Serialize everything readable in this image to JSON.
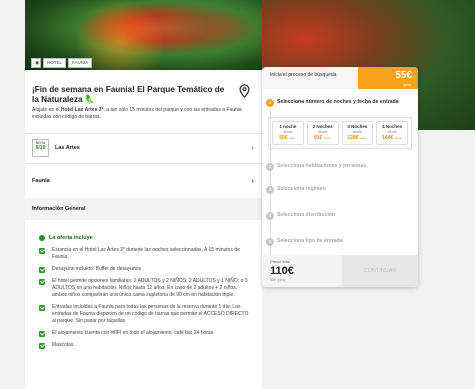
{
  "gallery": {
    "tags": [
      "HOTEL",
      "FAUNIA"
    ],
    "camera_icon": "camera-icon"
  },
  "hotel": {
    "title": "¡Fin de semana en Faunia! El Parque Temático de la Naturaleza 🦜",
    "subtitle_pre": "Alójate en el ",
    "subtitle_hotel": "Hotel Las Artes 3*",
    "subtitle_post": ", a tan sólo 15 minutos del parque y con las entradas a Faunia incluidas con código de barras.",
    "badge_top": "NOTA",
    "badge_score": "9/10",
    "name": "Las Artes"
  },
  "accordion": {
    "faunia": "Faunia",
    "info": "Información General"
  },
  "offer": {
    "title": "La oferta incluye",
    "items": [
      "Estancia en el Hotel Las Artes 3* durante las noches seleccionadas. A 15 minutos de Faunia.",
      "Desayuno incluido: Buffet de desayunos",
      "El hotel permite opciones familiares: 2 ADULTOS y 2 NIÑOS; 2 ADULTOS y 1 NIÑO; o 3 ADULTOS en una habitación. Niños hasta 12 años. En caso de 2 adultos + 2 niños, ambos niños compartirán una única cama supletoria de 90 cm en habitación triple.",
      "Entradas incluidas a Faunia para todas las personas de la reserva durante 1 día. Las entradas de Faunia disponen de un código de barras que permite el ACCESO DIRECTO al parque. Sin pasar por taquillas.",
      "El alojamiento cuenta con WIFI en todo el alojamiento, café bar 24 horas.",
      "Mascotas."
    ]
  },
  "booking": {
    "header": "Inicia el proceso de búsqueda",
    "price": "55€",
    "price_sub": "/pers.",
    "steps": [
      {
        "num": "1",
        "label": "Selecciona número de noches y fecha de entrada"
      },
      {
        "num": "2",
        "label": "Selecciona habitaciones y personas"
      },
      {
        "num": "3",
        "label": "Selecciona regimen"
      },
      {
        "num": "4",
        "label": "Selecciona distribución"
      },
      {
        "num": "5",
        "label": "Selecciona tipo de entrada"
      }
    ],
    "nights": [
      {
        "label": "1 noche",
        "from": "desde",
        "price": "55€",
        "unit": "/pers."
      },
      {
        "label": "2 Noches",
        "from": "desde",
        "price": "91€",
        "unit": "/pers."
      },
      {
        "label": "3 Noches",
        "from": "desde",
        "price": "128€",
        "unit": "/pers."
      },
      {
        "label": "4 Noches",
        "from": "desde",
        "price": "164€",
        "unit": "/pers."
      }
    ],
    "total_label": "Precio total",
    "total": "110€",
    "total_sub": "55€ /pers.",
    "continue": "CONTINUAR"
  }
}
